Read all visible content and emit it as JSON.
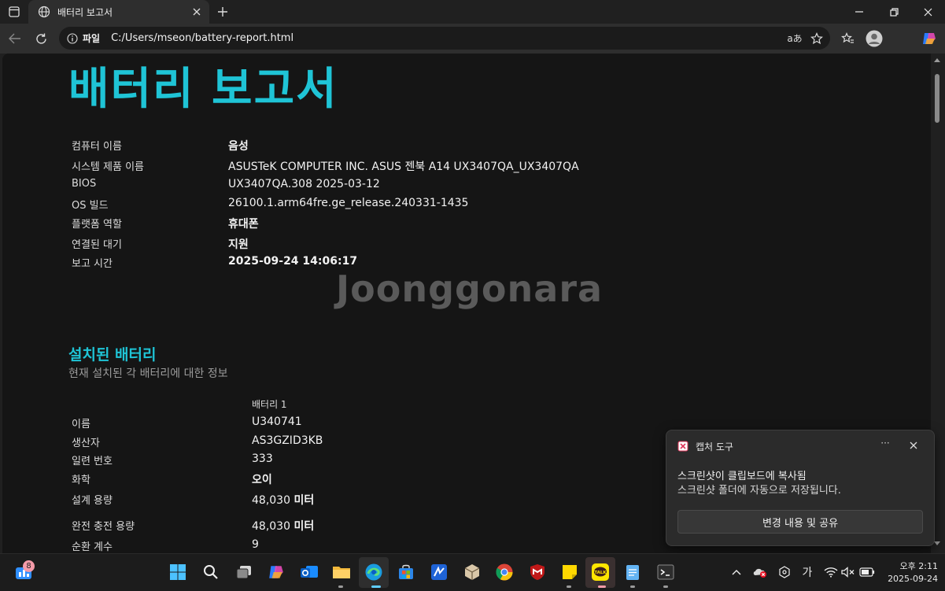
{
  "browser": {
    "tab_title": "배터리 보고서",
    "address_scheme": "파일",
    "address_url": "C:/Users/mseon/battery-report.html"
  },
  "report": {
    "title": "배터리 보고서",
    "system_info": [
      {
        "label": "컴퓨터 이름",
        "value": "음성",
        "bold": true
      },
      {
        "label": "시스템 제품 이름",
        "value": "ASUSTeK COMPUTER INC. ASUS 젠북 A14 UX3407QA_UX3407QA",
        "bold": false
      },
      {
        "label": "BIOS",
        "value": "UX3407QA.308 2025-03-12",
        "bold": false
      },
      {
        "label": "OS 빌드",
        "value": "26100.1.arm64fre.ge_release.240331-1435",
        "bold": false
      },
      {
        "label": "플랫폼 역할",
        "value": "휴대폰",
        "bold": true
      },
      {
        "label": "연결된 대기",
        "value": "지원",
        "bold": true
      },
      {
        "label": "보고 시간",
        "value": "2025-09-24  14:06:17",
        "bold": true
      }
    ],
    "watermark": "Joonggonara",
    "installed_heading": "설치된 배터리",
    "installed_subtitle": "현재 설치된 각 배터리에 대한 정보",
    "battery_column": "배터리 1",
    "battery_rows": [
      {
        "label": "이름",
        "value": "U340741",
        "unit": ""
      },
      {
        "label": "생산자",
        "value": "AS3GZID3KB",
        "unit": ""
      },
      {
        "label": "일련 번호",
        "value": "333",
        "unit": ""
      },
      {
        "label": "화학",
        "value": "",
        "unit": "오이"
      },
      {
        "label": "설계 용량",
        "value": "48,030 ",
        "unit": "미터"
      },
      {
        "label": "완전 충전 용량",
        "value": "48,030 ",
        "unit": "미터"
      },
      {
        "label": "순환 계수",
        "value": "9",
        "unit": ""
      }
    ]
  },
  "toast": {
    "app_name": "캡처 도구",
    "more": "···",
    "line1": "스크린샷이 클립보드에 복사됨",
    "line2": "스크린샷 폴더에 자동으로 저장됩니다.",
    "action_label": "변경 내용 및 공유"
  },
  "taskbar": {
    "widget_badge": "8",
    "tray_ime": "가",
    "clock_time": "오후 2:11",
    "clock_date": "2025-09-24"
  },
  "colors": {
    "accent_cyan": "#1fc4d6",
    "page_bg": "#151515",
    "chrome_bg": "#202020"
  }
}
